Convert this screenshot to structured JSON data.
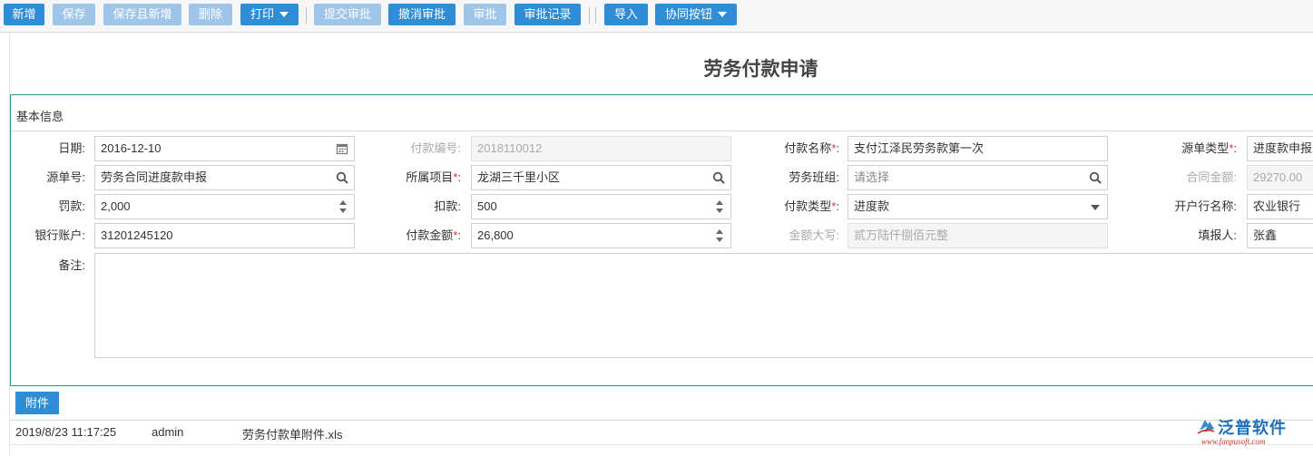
{
  "toolbar": {
    "buttons": {
      "new": "新增",
      "save": "保存",
      "save_new": "保存且新增",
      "delete": "删除",
      "print": "打印",
      "submit": "提交审批",
      "cancel_approval": "撤消审批",
      "approve": "审批",
      "approval_log": "审批记录",
      "import": "导入",
      "collab": "协同按钮"
    }
  },
  "page": {
    "title": "劳务付款申请"
  },
  "section": {
    "basic_info": "基本信息"
  },
  "form": {
    "date": {
      "label": "日期:",
      "value": "2016-12-10"
    },
    "pay_no": {
      "label": "付款编号:",
      "value": "2018110012"
    },
    "pay_name": {
      "label": "付款名称",
      "value": "支付江泽民劳务款第一次"
    },
    "source_type": {
      "label": "源单类型",
      "value": "进度款申报"
    },
    "source_no": {
      "label": "源单号:",
      "value": "劳务合同进度款申报"
    },
    "project": {
      "label": "所属项目",
      "value": "龙湖三千里小区"
    },
    "team": {
      "label": "劳务班组:",
      "placeholder": "请选择"
    },
    "contract_amount": {
      "label": "合同金额:",
      "value": "29270.00"
    },
    "penalty": {
      "label": "罚款:",
      "value": "2,000"
    },
    "deduction": {
      "label": "扣款:",
      "value": "500"
    },
    "pay_type": {
      "label": "付款类型",
      "value": "进度款"
    },
    "bank_name": {
      "label": "开户行名称:",
      "value": "农业银行"
    },
    "bank_account": {
      "label": "银行账户:",
      "value": "31201245120"
    },
    "pay_amount": {
      "label": "付款金额",
      "value": "26,800"
    },
    "amount_words": {
      "label": "金额大写:",
      "value": "贰万陆仟捌佰元整"
    },
    "reporter": {
      "label": "填报人:",
      "value": "张鑫"
    },
    "remarks": {
      "label": "备注:",
      "value": ""
    },
    "required_mark": "*",
    "colon": ":"
  },
  "attachments": {
    "button": "附件",
    "rows": [
      {
        "time": "2019/8/23 11:17:25",
        "user": "admin",
        "file": "劳务付款单附件.xls"
      }
    ]
  },
  "logo": {
    "name": "泛普软件",
    "url": "www.fanpusoft.com"
  },
  "colors": {
    "primary": "#2f8dd6",
    "disabled": "#9fc6e9",
    "panel_border": "#2b9a8a",
    "required": "#e03030"
  }
}
